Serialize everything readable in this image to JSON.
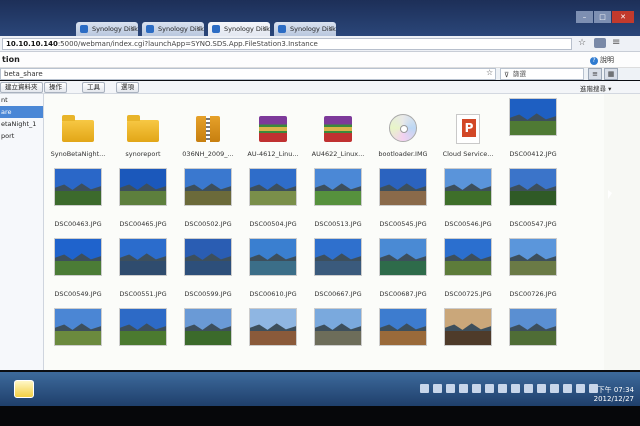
{
  "browser": {
    "tabs": [
      {
        "label": "Synology DiskStation"
      },
      {
        "label": "Synology DiskStation"
      },
      {
        "label": "Synology DiskStation"
      },
      {
        "label": "Synology DiskStation"
      }
    ],
    "url_host": "10.10.10.140",
    "url_rest": ":5000/webman/index.cgi?launchApp=SYNO.SDS.App.FileStation3.Instance"
  },
  "app": {
    "title": "tion",
    "help": "說明",
    "path": "beta_share",
    "search_placeholder": "篩選",
    "sort_label": "進階搜尋 ▾"
  },
  "toolbar": {
    "new_folder": "建立資料夾",
    "action": "操作",
    "tools": "工具",
    "settings": "選項"
  },
  "sidebar": {
    "items": [
      {
        "label": "nt"
      },
      {
        "label": "are"
      },
      {
        "label": "etaNight_1"
      },
      {
        "label": "port"
      }
    ]
  },
  "files": [
    {
      "name": "SynoBetaNight...",
      "kind": "folder"
    },
    {
      "name": "synoreport",
      "kind": "folder"
    },
    {
      "name": "036NH_2009_...",
      "kind": "zip"
    },
    {
      "name": "AU-4612_Linu...",
      "kind": "rar"
    },
    {
      "name": "AU4622_Linux...",
      "kind": "rar"
    },
    {
      "name": "bootloader.IMG",
      "kind": "cd"
    },
    {
      "name": "Cloud Service...",
      "kind": "ppt"
    },
    {
      "name": "DSC00412.JPG",
      "kind": "photo",
      "sky": "#1e5fc2",
      "land": "#4f7a34"
    },
    {
      "name": "DSC00463.JPG",
      "kind": "photo",
      "sky": "#2a67c8",
      "land": "#3c6a2c"
    },
    {
      "name": "DSC00465.JPG",
      "kind": "photo",
      "sky": "#1b58bb",
      "land": "#5d7f3d"
    },
    {
      "name": "DSC00502.JPG",
      "kind": "photo",
      "sky": "#3a78cf",
      "land": "#6b6a3a"
    },
    {
      "name": "DSC00504.JPG",
      "kind": "photo",
      "sky": "#2f6dc9",
      "land": "#7a8f4a"
    },
    {
      "name": "DSC00513.JPG",
      "kind": "photo",
      "sky": "#4b88d6",
      "land": "#56913d"
    },
    {
      "name": "DSC00545.JPG",
      "kind": "photo",
      "sky": "#2b63bf",
      "land": "#8a6a4a"
    },
    {
      "name": "DSC00546.JPG",
      "kind": "photo",
      "sky": "#5a94da",
      "land": "#3e6f2a"
    },
    {
      "name": "DSC00547.JPG",
      "kind": "photo",
      "sky": "#3b74c9",
      "land": "#2f5a26"
    },
    {
      "name": "DSC00549.JPG",
      "kind": "photo",
      "sky": "#1f63cc",
      "land": "#4b7c36"
    },
    {
      "name": "DSC00551.JPG",
      "kind": "photo",
      "sky": "#2b6ccc",
      "land": "#2f4c6e"
    },
    {
      "name": "DSC00599.JPG",
      "kind": "photo",
      "sky": "#2a5db3",
      "land": "#2d4f7a"
    },
    {
      "name": "DSC00610.JPG",
      "kind": "photo",
      "sky": "#3a7fd0",
      "land": "#3b6e88"
    },
    {
      "name": "DSC00667.JPG",
      "kind": "photo",
      "sky": "#2f70cd",
      "land": "#3a5a7c"
    },
    {
      "name": "DSC00687.JPG",
      "kind": "photo",
      "sky": "#4a8ad4",
      "land": "#2e6b4a"
    },
    {
      "name": "DSC00725.JPG",
      "kind": "photo",
      "sky": "#2b6fcf",
      "land": "#5d7c3a"
    },
    {
      "name": "DSC00726.JPG",
      "kind": "photo",
      "sky": "#5b96db",
      "land": "#6a7a46"
    },
    {
      "name": "",
      "kind": "photo",
      "sky": "#4b86d4",
      "land": "#6b8a3e"
    },
    {
      "name": "",
      "kind": "photo",
      "sky": "#2d6ac6",
      "land": "#4b7a2f"
    },
    {
      "name": "",
      "kind": "photo",
      "sky": "#6a9ad6",
      "land": "#3b6a2b"
    },
    {
      "name": "",
      "kind": "photo",
      "sky": "#8fb6e2",
      "land": "#8a5a3a"
    },
    {
      "name": "",
      "kind": "photo",
      "sky": "#7aa9dd",
      "land": "#6d6d5a"
    },
    {
      "name": "",
      "kind": "photo",
      "sky": "#3d7ccf",
      "land": "#9a6a3a"
    },
    {
      "name": "",
      "kind": "photo",
      "sky": "#caa77a",
      "land": "#4e3b2a"
    },
    {
      "name": "",
      "kind": "photo",
      "sky": "#5a8fd2",
      "land": "#4f6d36"
    }
  ],
  "taskbar": {
    "time": "下午 07:34",
    "date": "2012/12/27"
  }
}
